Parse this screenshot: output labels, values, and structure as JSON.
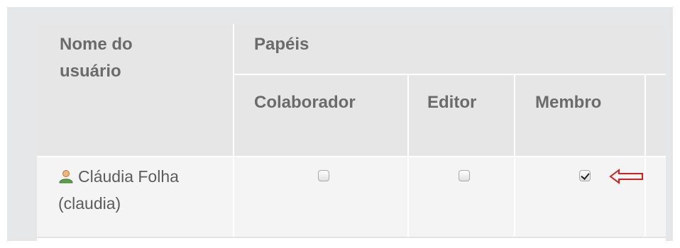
{
  "table": {
    "header": {
      "username_col": "Nome do usuário",
      "roles_group": "Papéis",
      "roles": [
        {
          "label": "Colaborador"
        },
        {
          "label": "Editor"
        },
        {
          "label": "Membro"
        }
      ]
    },
    "rows": [
      {
        "username": "Cláudia Folha (claudia)",
        "user_icon": "user-icon",
        "roles_checked": [
          false,
          false,
          true
        ]
      }
    ]
  },
  "annotation": {
    "arrow_icon": "left-arrow-icon",
    "arrow_color": "#d42020"
  }
}
